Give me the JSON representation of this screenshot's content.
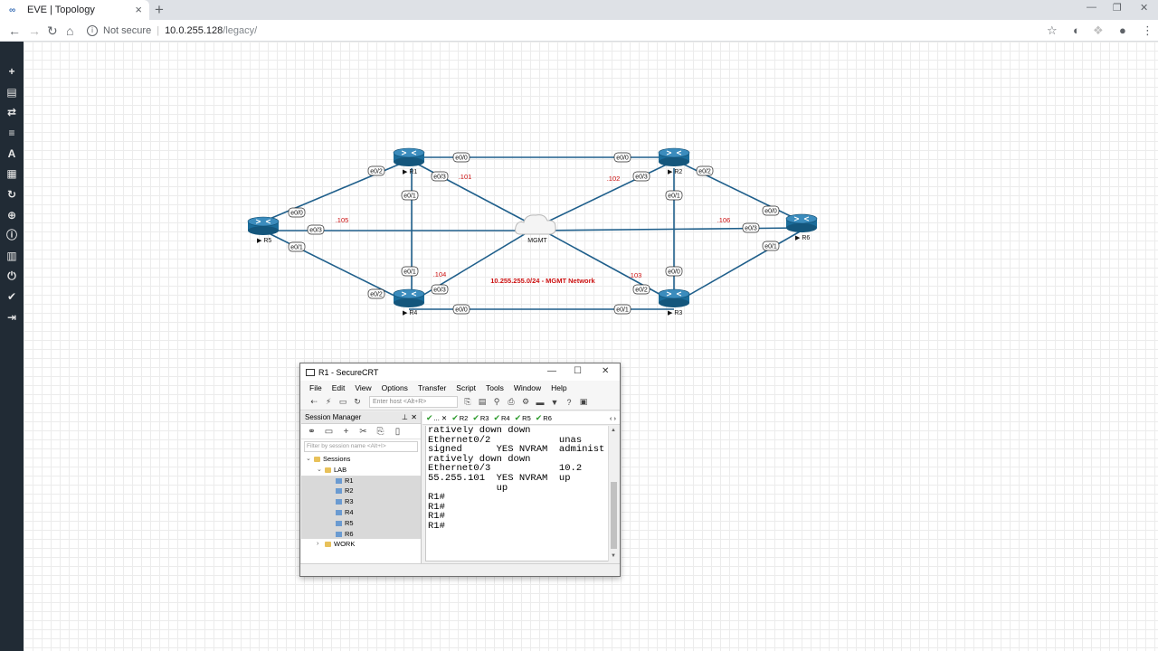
{
  "browser": {
    "tab_title": "EVE | Topology",
    "favicon": "eve-logo-icon",
    "new_tab_label": "+",
    "tab_close": "×",
    "security_label": "Not secure",
    "url_host": "10.0.255.128",
    "url_path": "/legacy/"
  },
  "sidebar": {
    "icons": [
      "add-icon",
      "node-icon",
      "network-icon",
      "list-icon",
      "text-icon",
      "grid-icon",
      "refresh-icon",
      "zoom-icon",
      "info-icon",
      "labs-icon",
      "power-icon",
      "check-icon",
      "logout-icon"
    ]
  },
  "topology": {
    "nodes": [
      {
        "name": "R1"
      },
      {
        "name": "R2"
      },
      {
        "name": "R3"
      },
      {
        "name": "R4"
      },
      {
        "name": "R5"
      },
      {
        "name": "R6"
      }
    ],
    "cloud_label": "MGMT",
    "network_label": "10.255.255.0/24 - MGMT Network",
    "accent_color": "#cc1111",
    "link_color": "#1f5f8b",
    "ip_labels": [
      ".101",
      ".102",
      ".103",
      ".104",
      ".105",
      ".106"
    ],
    "ports": [
      "e0/0",
      "e0/0",
      "e0/2",
      "e0/3",
      ".101",
      "e0/1",
      "e0/3",
      "e0/1",
      "e0/2",
      "e0/0",
      "e0/0",
      "e0/3",
      "e0/3",
      "e0/1",
      "e0/1",
      "e0/1",
      "e0/0",
      "e0/3",
      "e0/2",
      "e0/2",
      "e0/0",
      "e0/1"
    ]
  },
  "securecrt": {
    "title": "R1 - SecureCRT",
    "menu": [
      "File",
      "Edit",
      "View",
      "Options",
      "Transfer",
      "Script",
      "Tools",
      "Window",
      "Help"
    ],
    "host_placeholder": "Enter host <Alt+R>",
    "session_manager": {
      "title": "Session Manager",
      "filter_placeholder": "Filter by session name <Alt+I>",
      "tree": [
        {
          "label": "Sessions",
          "type": "folder",
          "level": 0,
          "expanded": true
        },
        {
          "label": "LAB",
          "type": "folder",
          "level": 1,
          "expanded": true
        },
        {
          "label": "R1",
          "type": "session",
          "level": 2
        },
        {
          "label": "R2",
          "type": "session",
          "level": 2
        },
        {
          "label": "R3",
          "type": "session",
          "level": 2
        },
        {
          "label": "R4",
          "type": "session",
          "level": 2
        },
        {
          "label": "R5",
          "type": "session",
          "level": 2
        },
        {
          "label": "R6",
          "type": "session",
          "level": 2
        },
        {
          "label": "WORK",
          "type": "folder",
          "level": 1,
          "expanded": false
        }
      ]
    },
    "tabs": [
      {
        "label": "...",
        "active": true
      },
      {
        "label": "R2"
      },
      {
        "label": "R3"
      },
      {
        "label": "R4"
      },
      {
        "label": "R5"
      },
      {
        "label": "R6"
      }
    ],
    "terminal_lines": [
      "ratively down down",
      "Ethernet0/2            unas",
      "signed      YES NVRAM  administ",
      "ratively down down",
      "Ethernet0/3            10.2",
      "55.255.101  YES NVRAM  up",
      "            up",
      "R1#",
      "R1#",
      "R1#",
      "R1#"
    ]
  }
}
